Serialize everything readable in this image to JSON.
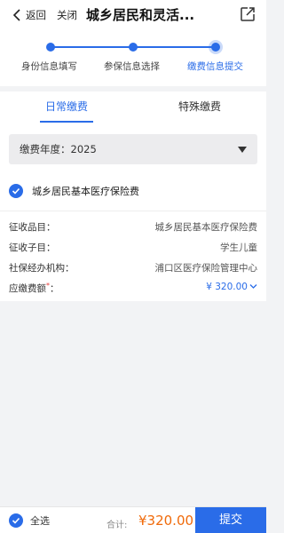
{
  "nav": {
    "back_label": "返回",
    "close_label": "关闭",
    "title": "城乡居民和灵活..."
  },
  "steps": [
    {
      "label": "身份信息填写",
      "state": "done"
    },
    {
      "label": "参保信息选择",
      "state": "done"
    },
    {
      "label": "缴费信息提交",
      "state": "active"
    }
  ],
  "tabs": [
    {
      "label": "日常缴费",
      "active": true
    },
    {
      "label": "特殊缴费",
      "active": false
    }
  ],
  "year_select": {
    "label": "缴费年度：",
    "value": "2025"
  },
  "fee_item": {
    "name": "城乡居民基本医疗保险费",
    "checked": true
  },
  "details": [
    {
      "key": "征收品目：",
      "value": "城乡居民基本医疗保险费"
    },
    {
      "key": "征收子目：",
      "value": "学生儿童"
    },
    {
      "key": "社保经办机构：",
      "value": "浦口区医疗保险管理中心"
    },
    {
      "key": "应缴费额",
      "required_mark": "*",
      "suffix": "：",
      "value": "¥ 320.00"
    }
  ],
  "footer": {
    "select_all_label": "全选",
    "total_label": "合计:",
    "total_value": "¥320.00",
    "submit_label": "提交"
  },
  "colors": {
    "accent": "#2a6ce8",
    "price": "#f06a0a",
    "required": "#e53935"
  }
}
